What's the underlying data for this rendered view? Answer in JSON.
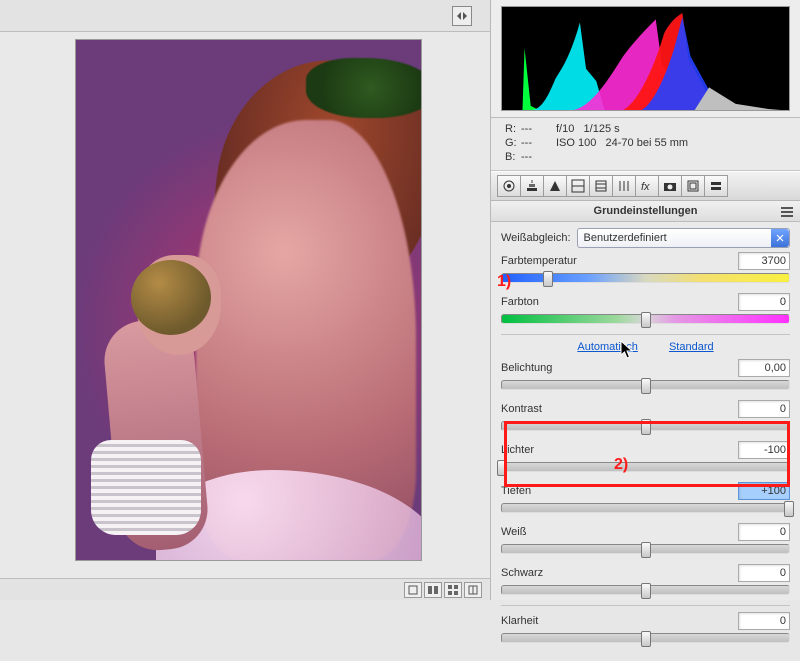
{
  "annotations": {
    "first": "1)",
    "second": "2)"
  },
  "readout": {
    "r_label": "R:",
    "r_val": "---",
    "g_label": "G:",
    "g_val": "---",
    "b_label": "B:",
    "b_val": "---",
    "aperture": "f/10",
    "shutter": "1/125 s",
    "iso": "ISO 100",
    "lens": "24-70 bei 55 mm"
  },
  "section_title": "Grundeinstellungen",
  "wb": {
    "label": "Weißabgleich:",
    "selected": "Benutzerdefiniert"
  },
  "sliders": {
    "temp": {
      "label": "Farbtemperatur",
      "value": "3700",
      "pos": 16
    },
    "tint": {
      "label": "Farbton",
      "value": "0",
      "pos": 50
    },
    "exposure": {
      "label": "Belichtung",
      "value": "0,00",
      "pos": 50
    },
    "contrast": {
      "label": "Kontrast",
      "value": "0",
      "pos": 50
    },
    "highlights": {
      "label": "Lichter",
      "value": "-100",
      "pos": 0
    },
    "shadows": {
      "label": "Tiefen",
      "value": "+100",
      "pos": 100
    },
    "whites": {
      "label": "Weiß",
      "value": "0",
      "pos": 50
    },
    "blacks": {
      "label": "Schwarz",
      "value": "0",
      "pos": 50
    },
    "clarity": {
      "label": "Klarheit",
      "value": "0",
      "pos": 50
    }
  },
  "links": {
    "auto": "Automatisch",
    "standard": "Standard"
  }
}
